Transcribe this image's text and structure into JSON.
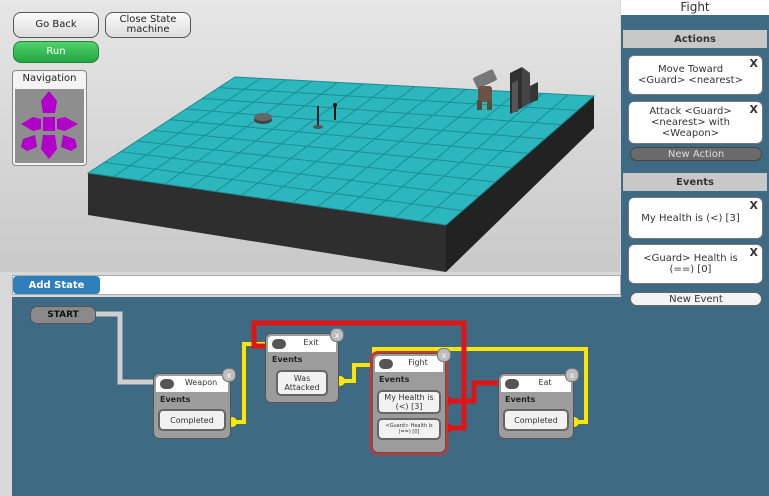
{
  "toolbar": {
    "go_back": "Go Back",
    "close_state_machine": "Close State machine",
    "run": "Run"
  },
  "navigation": {
    "title": "Navigation"
  },
  "editor": {
    "add_state": "Add State",
    "start": "START",
    "events_label": "Events",
    "close_glyph": "x",
    "nodes": {
      "weapon": {
        "name": "Weapon",
        "events": [
          "Completed"
        ]
      },
      "exit": {
        "name": "Exit",
        "events": [
          "Was Attacked"
        ]
      },
      "fight": {
        "name": "Fight",
        "events": [
          "My Health is (<) [3]",
          "<Guard> Health is (==) [0]"
        ]
      },
      "eat": {
        "name": "Eat",
        "events": [
          "Completed"
        ]
      }
    },
    "colors": {
      "wire_gray": "#cfcfcf",
      "wire_yellow": "#ffe600",
      "wire_red": "#e01414",
      "background": "#3f6a84"
    }
  },
  "sidebar": {
    "title": "Fight",
    "actions_header": "Actions",
    "actions": [
      "Move Toward <Guard> <nearest>",
      "Attack <Guard> <nearest> with <Weapon>"
    ],
    "new_action": "New Action",
    "events_header": "Events",
    "events": [
      "My Health is (<) [3]",
      "<Guard> Health is (==) [0]"
    ],
    "new_event": "New Event",
    "remove_glyph": "X"
  }
}
